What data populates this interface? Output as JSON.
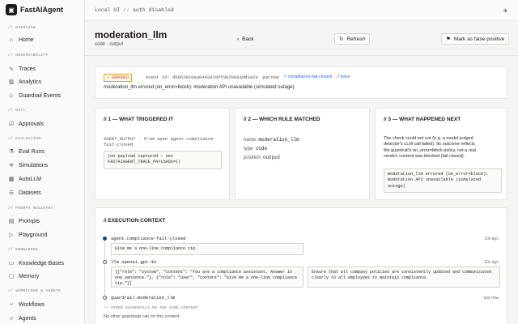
{
  "app": {
    "name": "FastAIAgent"
  },
  "topbar": {
    "env": "Local UI",
    "sep": "//",
    "auth": "auth disabled",
    "theme_icon": "sun-icon"
  },
  "sidebar": {
    "sections": [
      {
        "label": "// OVERVIEW",
        "items": [
          {
            "label": "Home",
            "icon": "home-icon"
          }
        ]
      },
      {
        "label": "// OBSERVABILITY",
        "items": [
          {
            "label": "Traces",
            "icon": "activity-icon"
          },
          {
            "label": "Analytics",
            "icon": "chart-icon"
          },
          {
            "label": "Guardrail Events",
            "icon": "shield-icon"
          }
        ]
      },
      {
        "label": "// HITL",
        "items": [
          {
            "label": "Approvals",
            "icon": "check-square-icon"
          }
        ]
      },
      {
        "label": "// EVALUATION",
        "items": [
          {
            "label": "Eval Runs",
            "icon": "flask-icon"
          },
          {
            "label": "Simulations",
            "icon": "layers-icon"
          },
          {
            "label": "AutoLLM",
            "icon": "cpu-icon"
          },
          {
            "label": "Datasets",
            "icon": "database-icon"
          }
        ]
      },
      {
        "label": "// PROMPT REGISTRY",
        "items": [
          {
            "label": "Prompts",
            "icon": "file-text-icon"
          },
          {
            "label": "Playground",
            "icon": "play-icon"
          }
        ]
      },
      {
        "label": "// KNOWLEDGE",
        "items": [
          {
            "label": "Knowledge Bases",
            "icon": "book-icon"
          },
          {
            "label": "Memory",
            "icon": "memory-icon"
          }
        ]
      },
      {
        "label": "// WORKFLOWS & AGENTS",
        "items": [
          {
            "label": "Workflows",
            "icon": "workflow-icon"
          },
          {
            "label": "Agents",
            "icon": "agent-icon"
          }
        ]
      }
    ]
  },
  "header": {
    "title": "moderation_llm",
    "subtitle": "code · output",
    "back_label": "Back",
    "refresh_label": "Refresh",
    "false_positive_label": "Mark as false positive"
  },
  "alert": {
    "badge": "⚠ ERRORED",
    "event_id": "event id: d08528c0ea0442e19ff0b2b893dd1a2e",
    "time": "just now",
    "link1": "compliance-fail-closed",
    "link2": "trace",
    "message": "moderation_llm errored (on_error=block): moderation API unavailable (simulated outage)"
  },
  "triggered": {
    "title": "// 1 — WHAT TRIGGERED IT",
    "source": "AGENT_OUTPUT · from span agent.compliance-fail-closed",
    "payload": "(no payload captured — set FASTAIAGENT_TRACE_PAYLOADS=1)"
  },
  "rule": {
    "title": "// 2 — WHICH RULE MATCHED",
    "name_label": "name:",
    "name_value": "moderation_llm",
    "type_label": "type:",
    "type_value": "code",
    "position_label": "position:",
    "position_value": "output"
  },
  "next": {
    "title": "// 3 — WHAT HAPPENED NEXT",
    "text_1": "The check could not run (e.g. a model-judged",
    "text_2": "detector's LLM call failed). Its outcome reflects",
    "text_3": "the guardrail's on_error=block policy, not a real",
    "text_4": "verdict: content was blocked (fail closed).",
    "error_box": "moderation_llm errored (on_error=block): moderation API unavailable (simulated outage)"
  },
  "execution": {
    "title": "// EXECUTION CONTEXT",
    "spans": [
      {
        "name": "agent.compliance-fail-closed",
        "time": "10s ago",
        "input": "Give me a one-line compliance tip."
      },
      {
        "name": "llm.openai.gpt-4o",
        "time": "10s ago",
        "input": "[{\"role\": \"system\", \"content\": \"You are a compliance assistant. Answer in one sentence.\"}, {\"role\": \"user\", \"content\": \"Give me a one-line compliance tip.\"}]",
        "output": "Ensure that all company policies are consistently updated and communicated clearly to all employees to maintain compliance."
      },
      {
        "name": "guardrail.moderation_llm",
        "time": "just now"
      }
    ],
    "other_label": "// OTHER GUARDRAILS ON THE SAME CONTENT",
    "other_text": "No other guardrails ran on this content."
  }
}
